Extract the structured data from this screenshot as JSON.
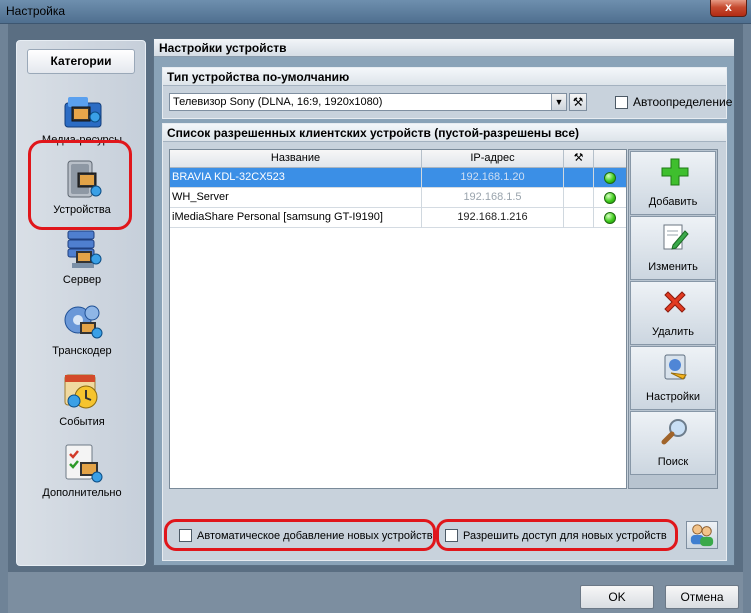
{
  "window": {
    "title": "Настройка",
    "close_label": "x"
  },
  "sidebar": {
    "header": "Категории",
    "items": [
      {
        "label": "Медиа-ресурсы",
        "icon": "media-resources-icon"
      },
      {
        "label": "Устройства",
        "icon": "devices-icon"
      },
      {
        "label": "Сервер",
        "icon": "server-icon"
      },
      {
        "label": "Транскодер",
        "icon": "transcoder-icon"
      },
      {
        "label": "События",
        "icon": "events-icon"
      },
      {
        "label": "Дополнительно",
        "icon": "advanced-icon"
      }
    ]
  },
  "main": {
    "title": "Настройки устройств",
    "default_type": {
      "title": "Тип устройства по-умолчанию",
      "selected": "Телевизор Sony (DLNA, 16:9, 1920x1080)",
      "auto_label": "Автоопределение"
    },
    "devices": {
      "title": "Список разрешенных клиентских устройств (пустой-разрешены все)",
      "columns": {
        "name": "Название",
        "ip": "IP-адрес"
      },
      "rows": [
        {
          "name": "BRAVIA KDL-32CX523",
          "ip": "192.168.1.20"
        },
        {
          "name": "WH_Server",
          "ip": "192.168.1.5"
        },
        {
          "name": "iMediaShare Personal [samsung GT-I9190]",
          "ip": "192.168.1.216"
        }
      ],
      "buttons": {
        "add": "Добавить",
        "edit": "Изменить",
        "delete": "Удалить",
        "settings": "Настройки",
        "search": "Поиск"
      }
    },
    "options": {
      "auto_add": "Автоматическое добавление новых устройств",
      "allow_new": "Разрешить доступ для новых устройств"
    }
  },
  "footer": {
    "ok": "OK",
    "cancel": "Отмена"
  },
  "colors": {
    "selection": "#3b8fe6",
    "highlight": "#e0161b",
    "status_green": "#3fcc1d"
  }
}
